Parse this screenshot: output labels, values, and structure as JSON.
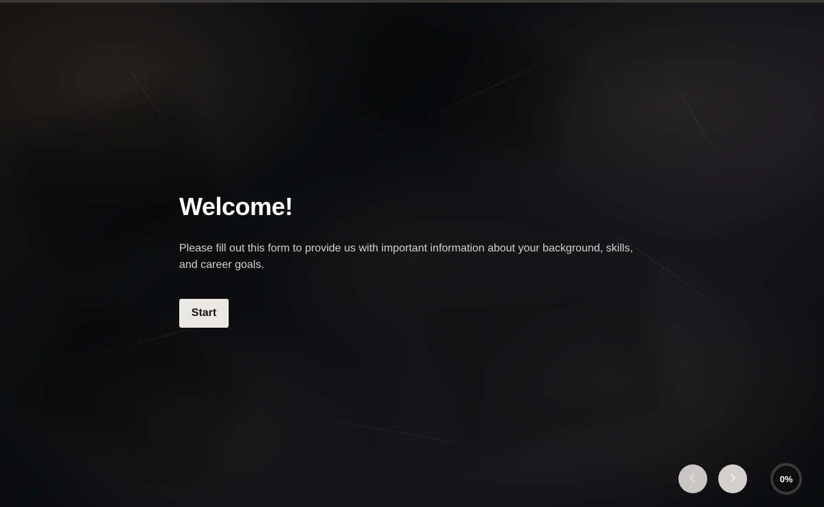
{
  "welcome": {
    "title": "Welcome!",
    "description": "Please fill out this form to provide us with important information about your background, skills, and career goals.",
    "start_label": "Start"
  },
  "navigation": {
    "prev_icon": "chevron-left-icon",
    "next_icon": "chevron-right-icon"
  },
  "progress": {
    "value": 0,
    "label": "0%"
  },
  "colors": {
    "button_background": "#ebe7e2",
    "nav_button": "#d2cfcc",
    "text_primary": "#ffffff",
    "text_secondary": "#d6d1cc"
  }
}
